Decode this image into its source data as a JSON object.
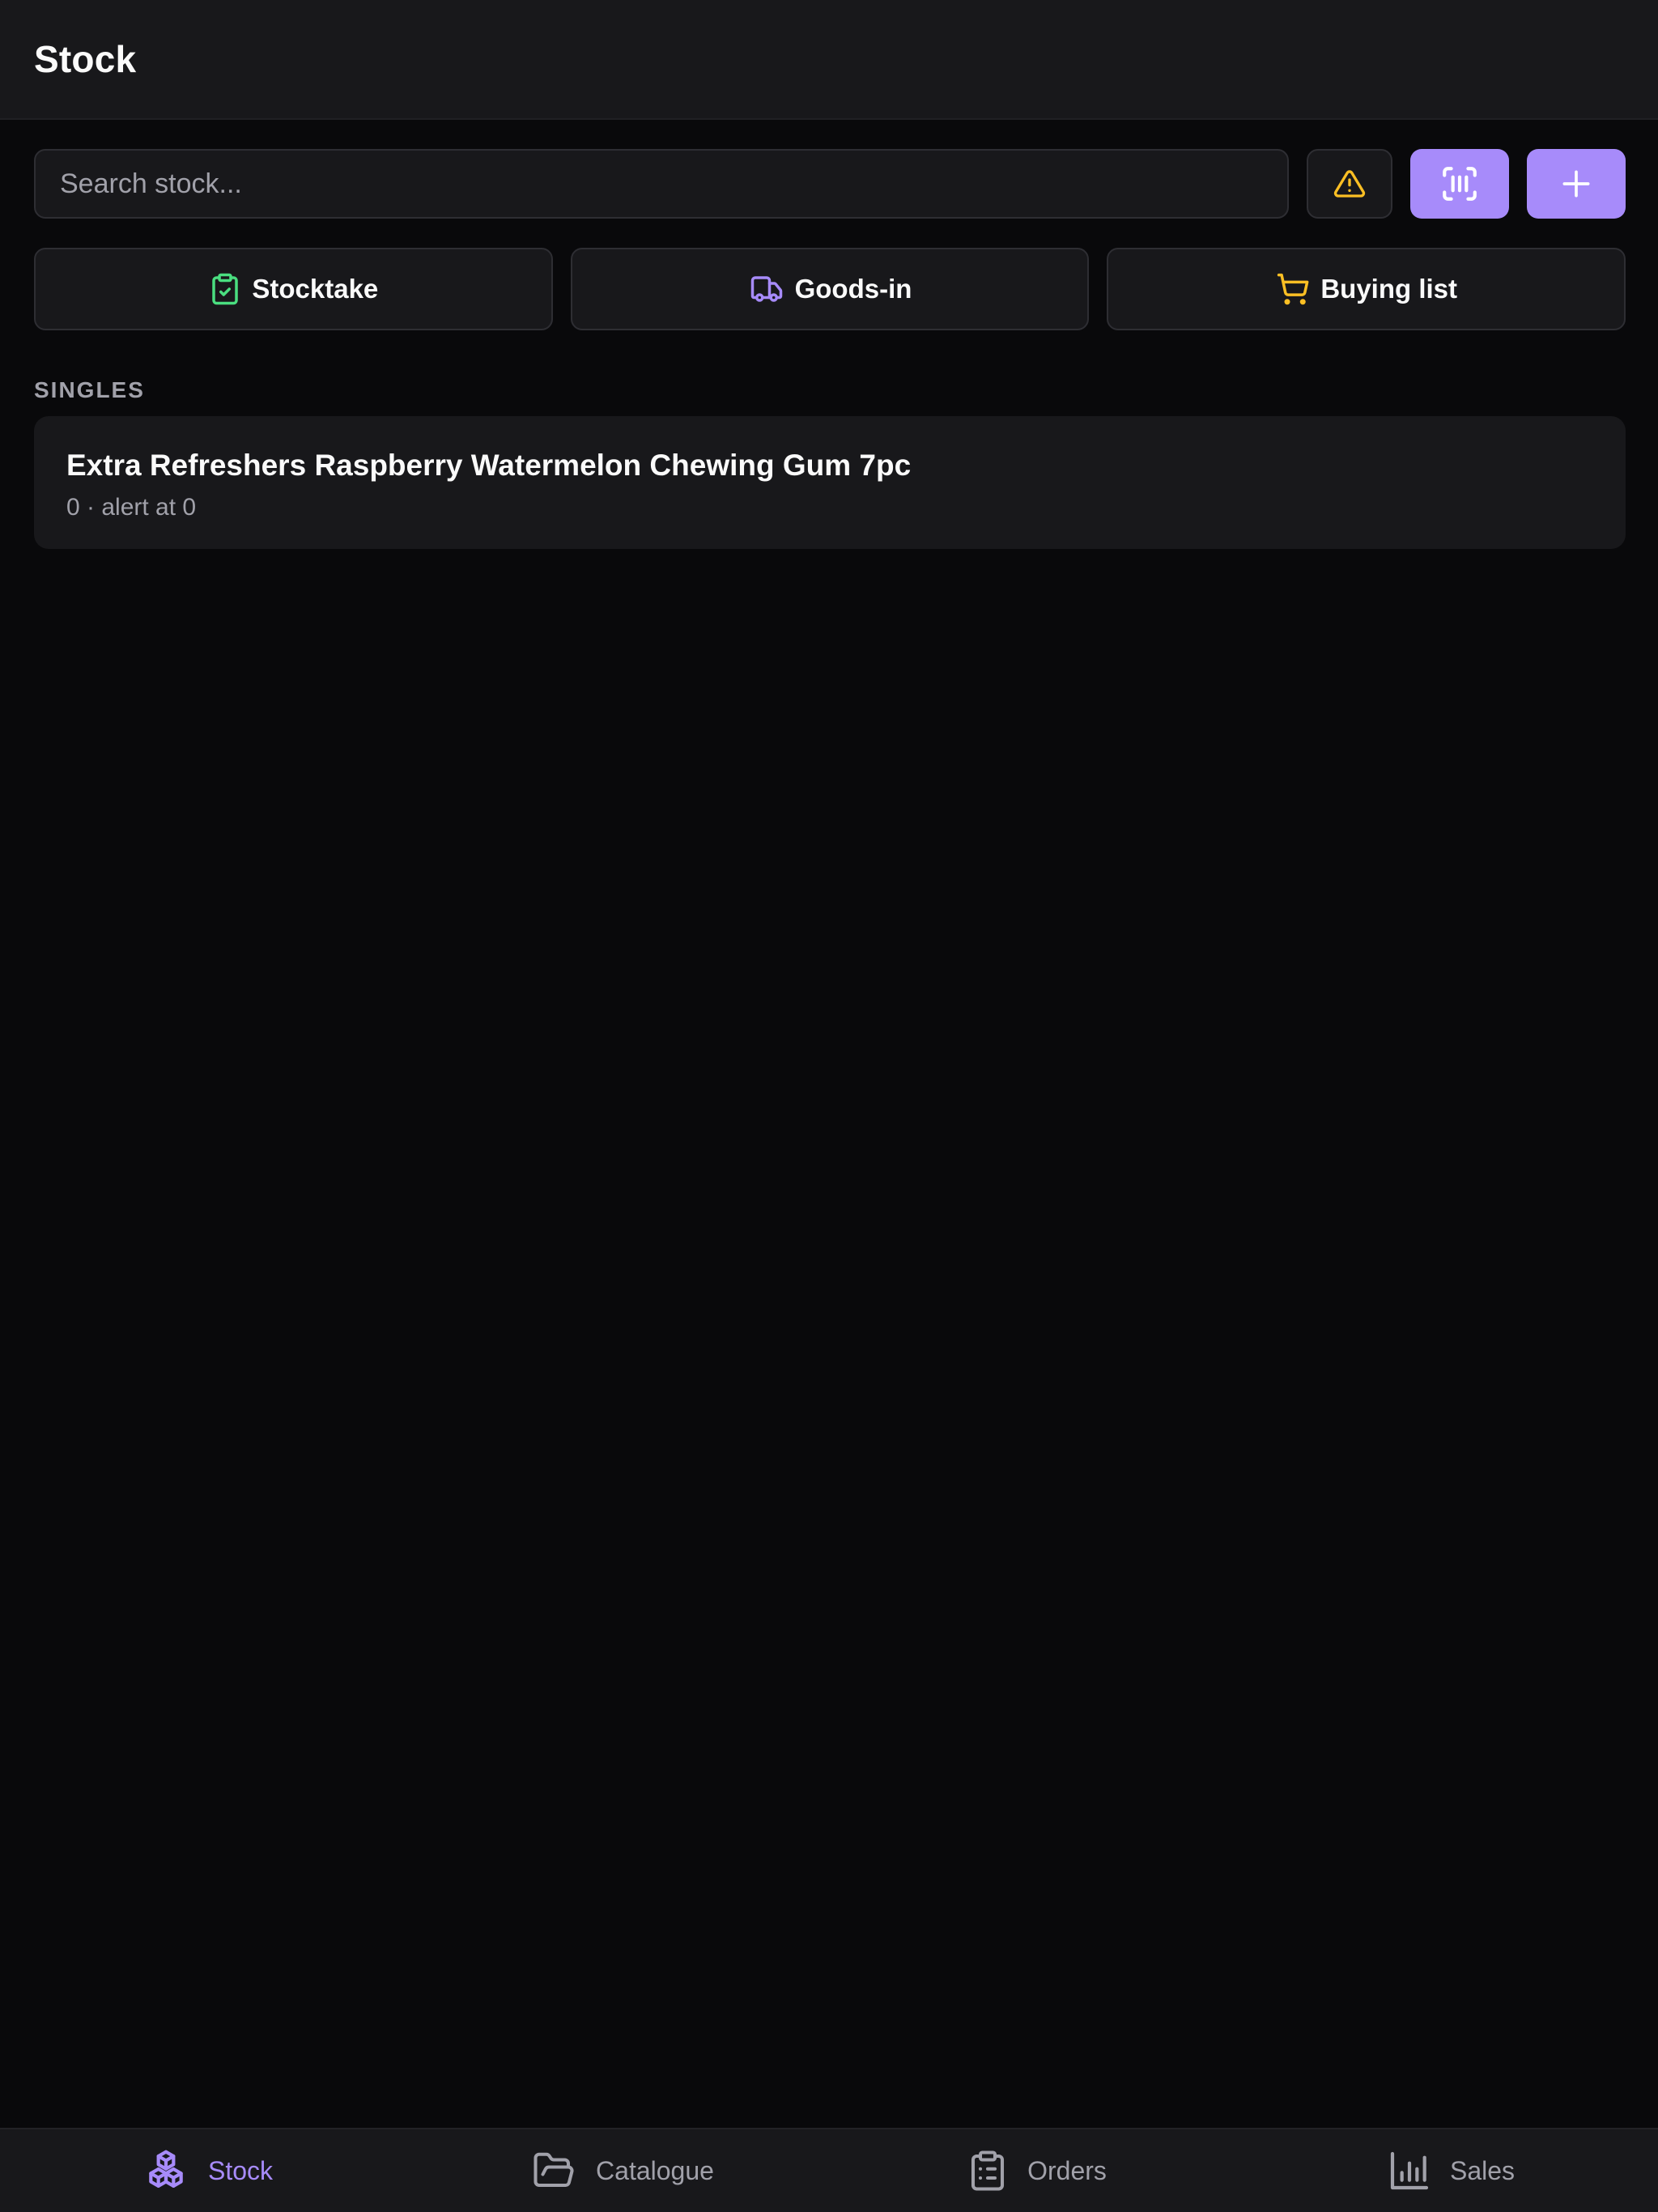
{
  "header": {
    "title": "Stock"
  },
  "search": {
    "placeholder": "Search stock...",
    "value": ""
  },
  "toolbar": {
    "alert_icon": "alert-triangle-icon",
    "scan_icon": "barcode-scan-icon",
    "add_icon": "plus-icon"
  },
  "actions": [
    {
      "label": "Stocktake",
      "icon": "clipboard-check-icon",
      "color": "#4ade80"
    },
    {
      "label": "Goods-in",
      "icon": "truck-icon",
      "color": "#a78bfa"
    },
    {
      "label": "Buying list",
      "icon": "shopping-cart-icon",
      "color": "#fbbf24"
    }
  ],
  "sections": [
    {
      "label": "SINGLES",
      "items": [
        {
          "name": "Extra Refreshers Raspberry Watermelon Chewing Gum 7pc",
          "meta": "0 · alert at 0"
        }
      ]
    }
  ],
  "nav": [
    {
      "label": "Stock",
      "icon": "boxes-icon",
      "active": true
    },
    {
      "label": "Catalogue",
      "icon": "folder-open-icon",
      "active": false
    },
    {
      "label": "Orders",
      "icon": "clipboard-list-icon",
      "active": false
    },
    {
      "label": "Sales",
      "icon": "bar-chart-icon",
      "active": false
    }
  ],
  "colors": {
    "accent": "#a78bfa",
    "background": "#09090b",
    "surface": "#18181b",
    "warning": "#fbbf24",
    "success": "#4ade80"
  }
}
